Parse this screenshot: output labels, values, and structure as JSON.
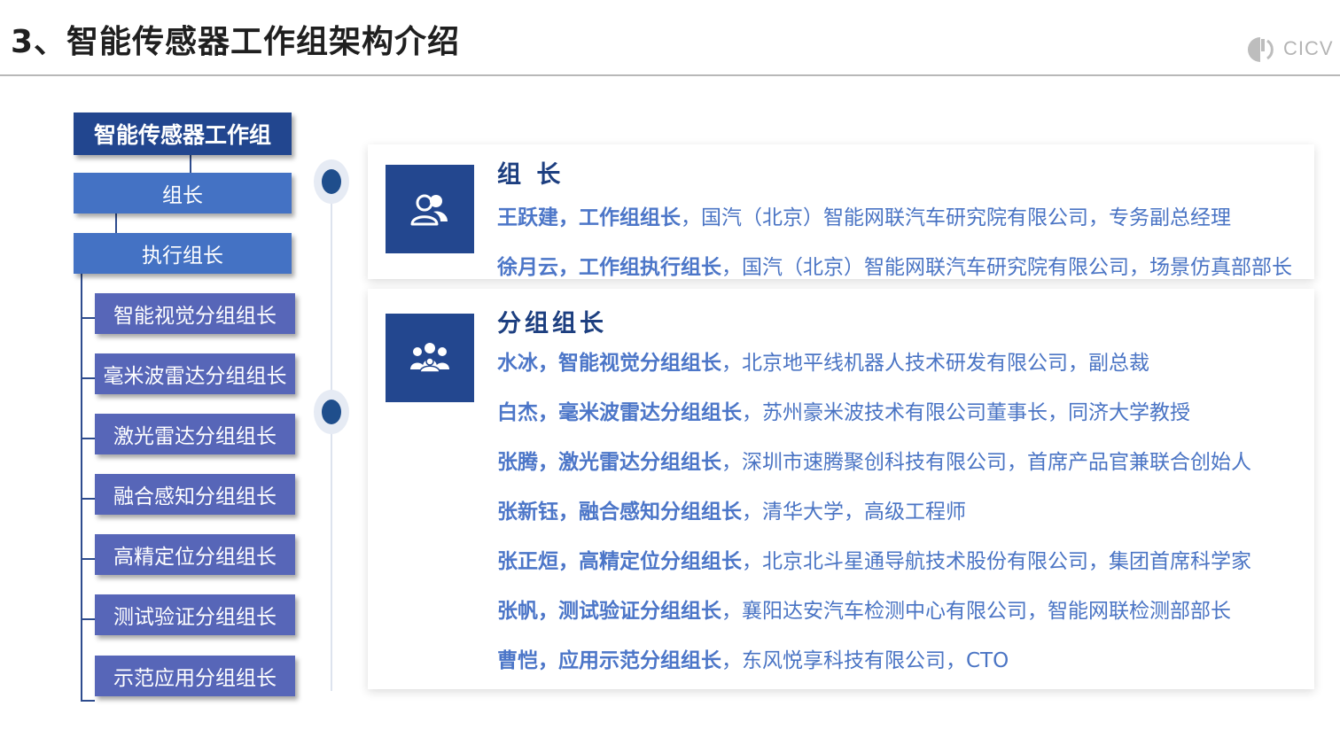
{
  "header": {
    "title": "3、智能传感器工作组架构介绍",
    "logo_text": "CICV"
  },
  "org_chart": {
    "root": "智能传感器工作组",
    "leader": "组长",
    "executive_leader": "执行组长",
    "subgroups": [
      "智能视觉分组组长",
      "毫米波雷达分组组长",
      "激光雷达分组组长",
      "融合感知分组组长",
      "高精定位分组组长",
      "测试验证分组组长",
      "示范应用分组组长"
    ]
  },
  "leaders_section": {
    "title": "组 长",
    "icon": "users-icon",
    "rows": [
      {
        "name_role": "王跃建，工作组组长",
        "detail": "，国汽（北京）智能网联汽车研究院有限公司，专务副总经理"
      },
      {
        "name_role": "徐月云，工作组执行组长",
        "detail": "，国汽（北京）智能网联汽车研究院有限公司，场景仿真部部长"
      }
    ]
  },
  "subgroup_section": {
    "title": "分组组长",
    "icon": "team-icon",
    "rows": [
      {
        "name_role": "水冰，智能视觉分组组长",
        "detail": "，北京地平线机器人技术研发有限公司，副总裁"
      },
      {
        "name_role": "白杰，毫米波雷达分组组长",
        "detail": "，苏州豪米波技术有限公司董事长，同济大学教授"
      },
      {
        "name_role": "张腾，激光雷达分组组长",
        "detail": "，深圳市速腾聚创科技有限公司，首席产品官兼联合创始人"
      },
      {
        "name_role": "张新钰，融合感知分组组长",
        "detail": "，清华大学，高级工程师"
      },
      {
        "name_role": "张正烜，高精定位分组组长",
        "detail": "，北京北斗星通导航技术股份有限公司，集团首席科学家"
      },
      {
        "name_role": "张帆，测试验证分组组长",
        "detail": "，襄阳达安汽车检测中心有限公司，智能网联检测部部长"
      },
      {
        "name_role": "曹恺，应用示范分组组长",
        "detail": "，东风悦享科技有限公司，CTO"
      }
    ]
  },
  "colors": {
    "navy": "#22468f",
    "blue": "#4472c4",
    "purple_blue": "#5766b8",
    "text_blue": "#4a74c4"
  }
}
